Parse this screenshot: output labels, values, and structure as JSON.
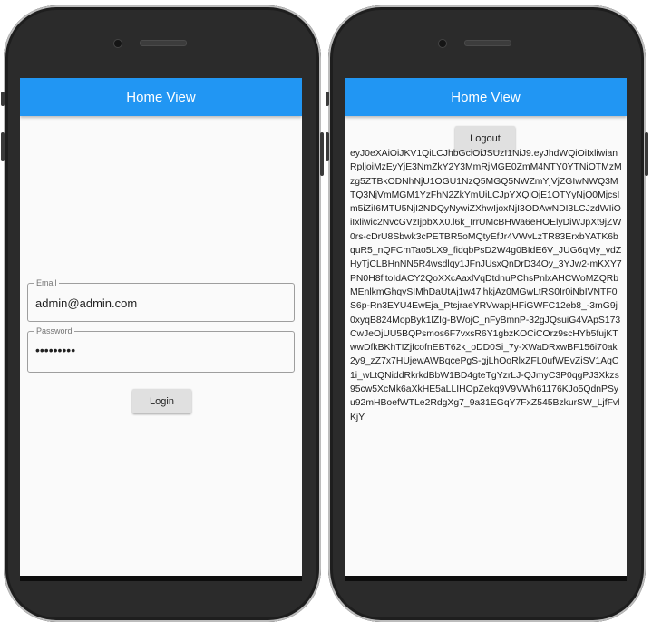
{
  "login_screen": {
    "app_bar_title": "Home View",
    "email_field": {
      "label": "Email",
      "value": "admin@admin.com"
    },
    "password_field": {
      "label": "Password",
      "value": "•••••••••"
    },
    "login_button": "Login"
  },
  "token_screen": {
    "app_bar_title": "Home View",
    "logout_button": "Logout",
    "token_text": "eyJ0eXAiOiJKV1QiLCJhbGciOiJSUzI1NiJ9.eyJhdWQiOiIxliwianRpljoiMzEyYjE3NmZkY2Y3MmRjMGE0ZmM4NTY0YTNiOTMzMzg5ZTBkODNhNjU1OGU1NzQ5MGQ5NWZmYjVjZGIwNWQ3MTQ3NjVmMGM1YzFhN2ZkYmUiLCJpYXQiOjE1OTYyNjQ0MjcsIm5iZiI6MTU5NjI2NDQyNywiZXhwIjoxNjI3ODAwNDI3LCJzdWIiOiIxliwic2NvcGVzIjpbXX0.l6k_IrrUMcBHWa6eHOElyDiWJpXt9jZW0rs-cDrU8Sbwk3cPETBR5oMQtyEfJr4VWvLzTR83ErxbYATK6bquR5_nQFCmTao5LX9_fidqbPsD2W4g0BIdE6V_JUG6qMy_vdZHyTjCLBHnNN5R4wsdlqy1JFnJUsxQnDrD34Oy_3YJw2-mKXY7PN0H8fltoIdACY2QoXXcAaxlVqDtdnuPChsPnlxAHCWoMZQRbMEnlkmGhqySIMhDaUtAj1w47ihkjAz0MGwLtRS0Ir0iNbIVNTF0S6p-Rn3EYU4EwEja_PtsjraeYRVwapjHFiGWFC12eb8_-3mG9j0xyqB824MopByk1lZIg-BWojC_nFyBmnP-32gJQsuiG4VApS173CwJeOjUU5BQPsmos6F7vxsR6Y1gbzKOCiCOrz9scHYb5fujKTwwDfkBKhTIZjfcofnEBT62k_oDD0Si_7y-XWaDRxwBF156i70ak2y9_zZ7x7HUjewAWBqcePgS-gjLhOoRlxZFL0ufWEvZiSV1AqC1i_wLtQNiddRkrkdBbW1BD4gteTgYzrLJ-QJmyC3P0qgPJ3Xkzs95cw5XcMk6aXkHE5aLLIHOpZekq9V9VWh61176KJo5QdnPSyu92mHBoefWTLe2RdgXg7_9a31EGqY7FxZ545BzkurSW_LjfFvlKjY"
  }
}
